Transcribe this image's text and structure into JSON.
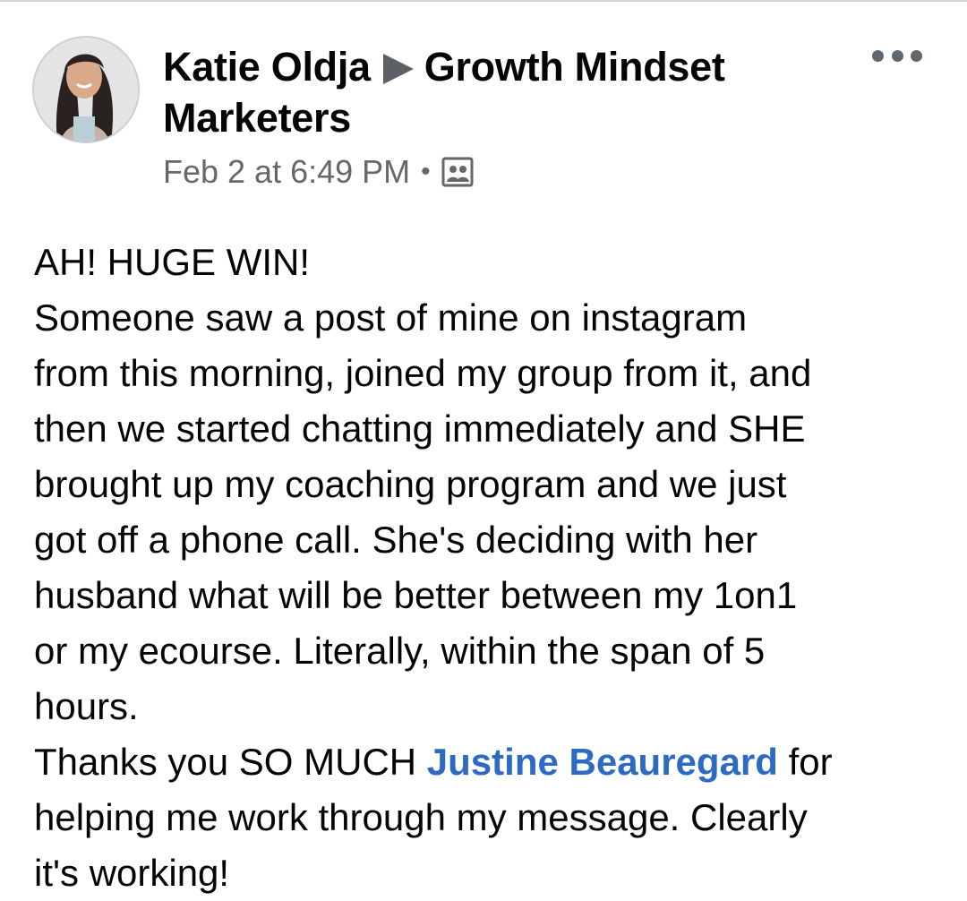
{
  "post": {
    "author_name": "Katie Oldja",
    "group_name_line1": "Growth Mindset",
    "group_name_line2": "Marketers",
    "timestamp": "Feb 2 at 6:49 PM",
    "separator": "•",
    "privacy_icon": "group-members-icon",
    "more_icon": "more-options-icon",
    "body_lines": [
      "AH! HUGE WIN!",
      "Someone saw a post of mine on instagram",
      "from this morning, joined my group from it, and",
      "then we started chatting immediately and SHE",
      "brought up my coaching program and we just",
      "got off a phone call. She's deciding with her",
      "husband what will be better between my 1on1",
      "or my ecourse. Literally, within the span of 5",
      "hours."
    ],
    "thanks_prefix": "Thanks you SO MUCH ",
    "mention_name": "Justine Beauregard",
    "thanks_suffix": " for",
    "closing_lines": [
      "helping me work through my message. Clearly",
      "it's working!"
    ]
  },
  "colors": {
    "text": "#050505",
    "meta": "#65676b",
    "mention": "#2d6bc3",
    "icon": "#606770"
  }
}
